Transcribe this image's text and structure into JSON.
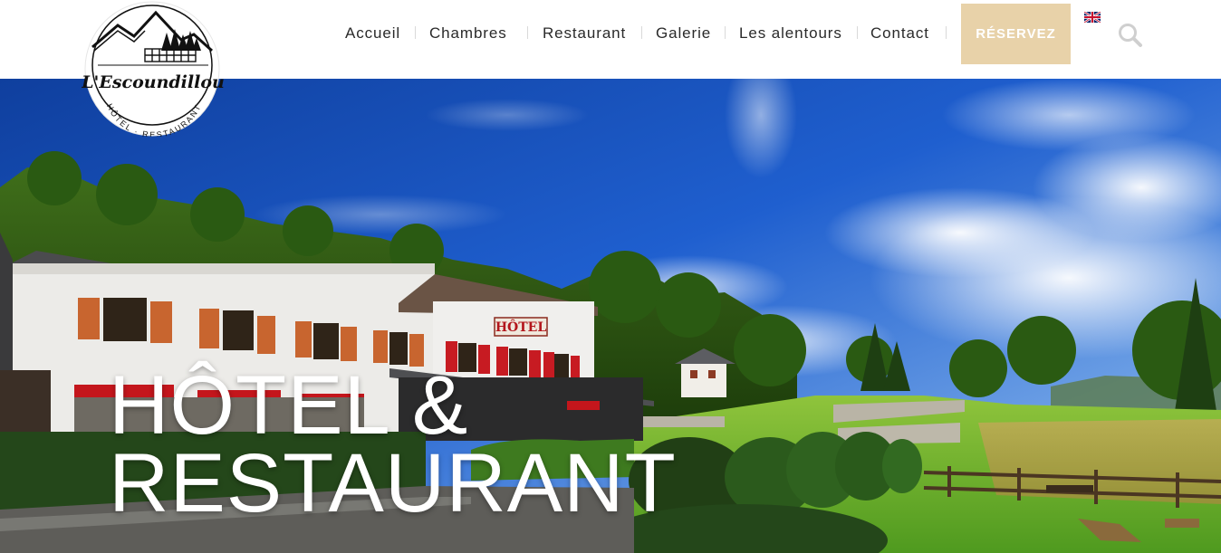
{
  "brand": {
    "name": "L'Escoundillou",
    "tagline": "HÔTEL · RESTAURANT"
  },
  "nav": {
    "items": [
      {
        "label": "Accueil"
      },
      {
        "label": "Chambres"
      },
      {
        "label": "Restaurant"
      },
      {
        "label": "Galerie"
      },
      {
        "label": "Les alentours"
      },
      {
        "label": "Contact"
      }
    ],
    "reserve_label": "RÉSERVEZ",
    "language_icon": "uk-flag-icon",
    "search_icon": "search-icon"
  },
  "hero": {
    "title_line1": "HÔTEL &",
    "title_line2": "RESTAURANT",
    "building_sign": "HÔTEL"
  },
  "colors": {
    "accent": "#e8d2a9",
    "nav_text": "#2a2a2a",
    "shutters": "#c8652f",
    "awning": "#c4161c"
  }
}
